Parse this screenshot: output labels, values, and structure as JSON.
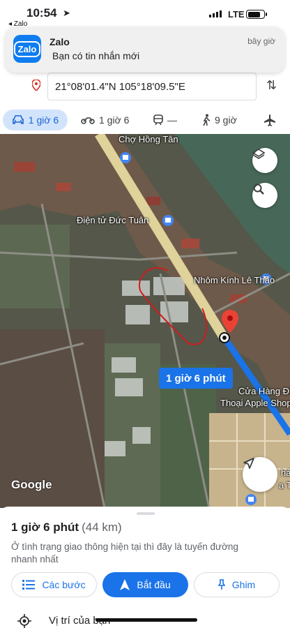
{
  "status_bar": {
    "time": "10:54",
    "back_label": "◂ Zalo",
    "network": "LTE"
  },
  "notification": {
    "app_icon_label": "Zalo",
    "app_name": "Zalo",
    "message": "Bạn có tin nhắn mới",
    "time": "bây giờ"
  },
  "destination": {
    "coordinates": "21°08'01.4\"N 105°18'09.5\"E"
  },
  "modes": [
    {
      "name": "car",
      "label": "1 giờ 6"
    },
    {
      "name": "motorbike",
      "label": "1 giờ 6"
    },
    {
      "name": "transit",
      "label": "—"
    },
    {
      "name": "walk",
      "label": "9 giờ"
    },
    {
      "name": "flight",
      "label": ""
    }
  ],
  "map": {
    "labels": {
      "cho_hong_tan": "Chợ Hồng Tân",
      "dien_tu": "Điện tử Đức Tuân",
      "nhom_kinh": "Nhôm Kính Lê Thảo",
      "cua_hang_1": "Cửa Hàng Điệ",
      "cua_hang_2": "Thoại Apple Shop",
      "ha": "hả",
      "a_ti": "a Ti"
    },
    "route_badge": "1 giờ 6 phút",
    "attribution": "Google",
    "route_color": "#1a73e8"
  },
  "sheet": {
    "duration": "1 giờ 6 phút",
    "distance": "(44 km)",
    "description": "Ở tình trạng giao thông hiện tại thì đây là tuyến đường nhanh nhất",
    "steps_button": "Các bước",
    "start_button": "Bắt đầu",
    "pin_button": "Ghim",
    "my_position": "Vị trí của bạn"
  }
}
